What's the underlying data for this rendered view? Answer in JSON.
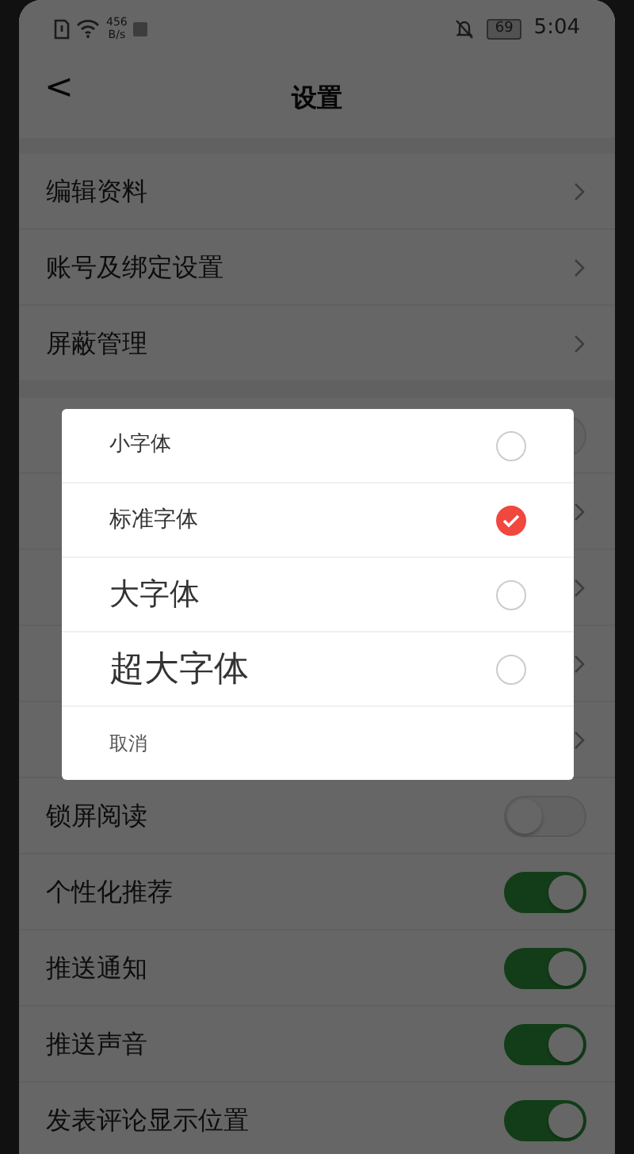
{
  "status_bar": {
    "net_speed_value": "456",
    "net_speed_unit": "B/s",
    "battery": "69",
    "time": "5:04"
  },
  "header": {
    "back": "<",
    "title": "设置"
  },
  "sections": [
    {
      "rows": [
        {
          "kind": "link",
          "label": "编辑资料"
        },
        {
          "kind": "link",
          "label": "账号及绑定设置"
        },
        {
          "kind": "link",
          "label": "屏蔽管理"
        }
      ]
    },
    {
      "rows": [
        {
          "kind": "toggle",
          "on": false
        },
        {
          "kind": "link"
        },
        {
          "kind": "link"
        },
        {
          "kind": "link"
        },
        {
          "kind": "link"
        },
        {
          "kind": "toggle",
          "label": "锁屏阅读",
          "on": false
        },
        {
          "kind": "toggle",
          "label": "个性化推荐",
          "on": true
        },
        {
          "kind": "toggle",
          "label": "推送通知",
          "on": true
        },
        {
          "kind": "toggle",
          "label": "推送声音",
          "on": true
        },
        {
          "kind": "toggle",
          "label": "发表评论显示位置",
          "on": true
        }
      ]
    }
  ],
  "dialog": {
    "options": [
      {
        "label": "小字体",
        "selected": false
      },
      {
        "label": "标准字体",
        "selected": true
      },
      {
        "label": "大字体",
        "selected": false
      },
      {
        "label": "超大字体",
        "selected": false
      }
    ],
    "cancel": "取消"
  }
}
